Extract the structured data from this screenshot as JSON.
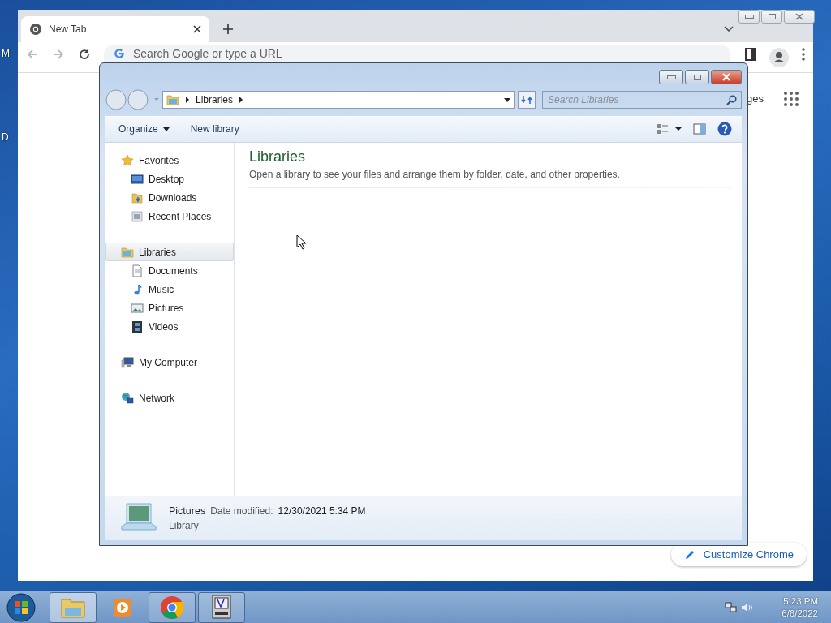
{
  "desktop": {
    "icon_labels": [
      "M",
      "D"
    ]
  },
  "browser": {
    "tab": {
      "title": "New Tab",
      "selected": true
    },
    "address": {
      "placeholder": "Search Google or type a URL"
    },
    "page_link": "ges",
    "customize_button": "Customize Chrome"
  },
  "explorer": {
    "breadcrumb": [
      "Libraries"
    ],
    "search": {
      "placeholder": "Search Libraries"
    },
    "toolbar": [
      {
        "label": "Organize",
        "has_menu": true
      },
      {
        "label": "New library",
        "has_menu": false
      }
    ],
    "nav": [
      {
        "label": "Favorites",
        "kind": "star",
        "selected": false,
        "children": [
          {
            "label": "Desktop",
            "kind": "desktop",
            "selected": false
          },
          {
            "label": "Downloads",
            "kind": "downloads",
            "selected": false
          },
          {
            "label": "Recent Places",
            "kind": "recent",
            "selected": false
          }
        ]
      },
      {
        "label": "Libraries",
        "kind": "library",
        "selected": true,
        "children": [
          {
            "label": "Documents",
            "kind": "document",
            "selected": false
          },
          {
            "label": "Music",
            "kind": "music",
            "selected": false
          },
          {
            "label": "Pictures",
            "kind": "pictures",
            "selected": false
          },
          {
            "label": "Videos",
            "kind": "videos",
            "selected": false
          }
        ]
      },
      {
        "label": "My Computer",
        "kind": "computer",
        "selected": false
      },
      {
        "label": "Network",
        "kind": "network",
        "selected": false
      }
    ],
    "content": {
      "title": "Libraries",
      "description": "Open a library to see your files and arrange them by folder, date, and other properties."
    },
    "details": {
      "name": "Pictures",
      "meta_label": "Date modified:",
      "meta_value": "12/30/2021 5:34 PM",
      "type": "Library"
    }
  },
  "taskbar": {
    "items": [
      {
        "kind": "folder",
        "running": true,
        "selected": true
      },
      {
        "kind": "media",
        "running": false,
        "selected": false
      },
      {
        "kind": "chrome",
        "running": true,
        "selected": false
      },
      {
        "kind": "app",
        "running": true,
        "selected": false
      }
    ],
    "clock": {
      "time": "5:23 PM",
      "date": "6/6/2022"
    }
  }
}
